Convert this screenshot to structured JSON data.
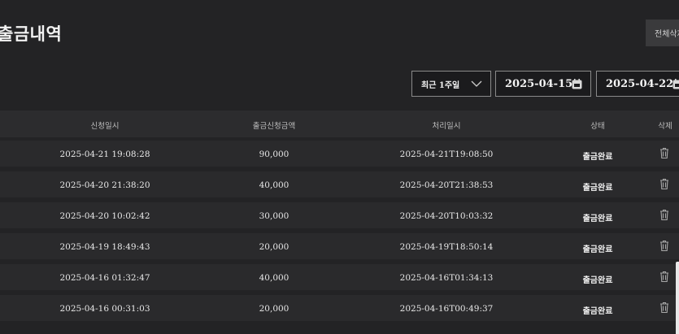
{
  "page": {
    "title": "출금내역",
    "delete_all_label": "전체삭제"
  },
  "filters": {
    "period_label": "최근 1주일",
    "start_date": "2025-04-15",
    "end_date": "2025-04-22"
  },
  "table": {
    "headers": {
      "requested_at": "신청일시",
      "amount": "출금신청금액",
      "processed_at": "처리일시",
      "status": "상태",
      "delete": "삭제"
    },
    "rows": [
      {
        "requested_at": "2025-04-21 19:08:28",
        "amount": "90,000",
        "processed_at": "2025-04-21T19:08:50",
        "status": "출금완료"
      },
      {
        "requested_at": "2025-04-20 21:38:20",
        "amount": "40,000",
        "processed_at": "2025-04-20T21:38:53",
        "status": "출금완료"
      },
      {
        "requested_at": "2025-04-20 10:02:42",
        "amount": "30,000",
        "processed_at": "2025-04-20T10:03:32",
        "status": "출금완료"
      },
      {
        "requested_at": "2025-04-19 18:49:43",
        "amount": "20,000",
        "processed_at": "2025-04-19T18:50:14",
        "status": "출금완료"
      },
      {
        "requested_at": "2025-04-16 01:32:47",
        "amount": "40,000",
        "processed_at": "2025-04-16T01:34:13",
        "status": "출금완료"
      },
      {
        "requested_at": "2025-04-16 00:31:03",
        "amount": "20,000",
        "processed_at": "2025-04-16T00:49:37",
        "status": "출금완료"
      }
    ]
  },
  "icons": {
    "period_dropdown": "chevron-down-icon",
    "date_picker": "calendar-icon",
    "row_delete": "trash-icon"
  },
  "colors": {
    "background": "#232325",
    "row_background": "#2a2a2c",
    "header_background": "#2c2c2e",
    "input_border": "#8a8a8a"
  }
}
